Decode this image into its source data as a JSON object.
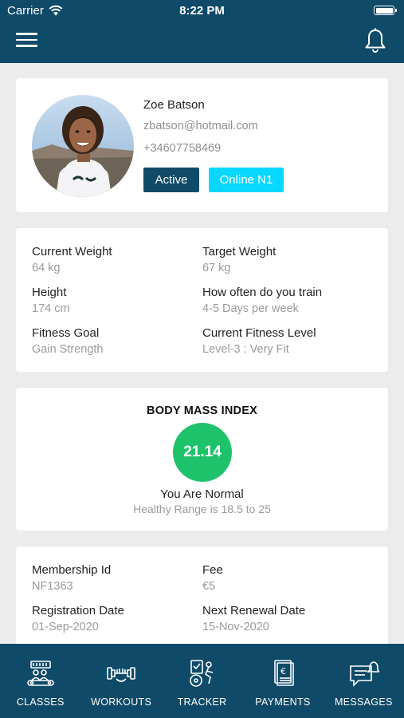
{
  "status_bar": {
    "carrier": "Carrier",
    "time": "8:22 PM"
  },
  "profile": {
    "name": "Zoe Batson",
    "email": "zbatson@hotmail.com",
    "phone": "+34607758469",
    "status_badge": "Active",
    "plan_badge": "Online N1"
  },
  "details": {
    "current_weight": {
      "label": "Current Weight",
      "value": "64 kg"
    },
    "target_weight": {
      "label": "Target Weight",
      "value": "67 kg"
    },
    "height": {
      "label": "Height",
      "value": "174 cm"
    },
    "training_frequency": {
      "label": "How often do you train",
      "value": "4-5 Days per week"
    },
    "fitness_goal": {
      "label": "Fitness Goal",
      "value": "Gain Strength"
    },
    "fitness_level": {
      "label": "Current Fitness Level",
      "value": "Level-3 : Very Fit"
    }
  },
  "bmi": {
    "title": "BODY MASS INDEX",
    "value": "21.14",
    "status": "You Are Normal",
    "range": "Healthy Range is 18.5 to 25",
    "color": "#1ec26a"
  },
  "membership": {
    "membership_id": {
      "label": "Membership Id",
      "value": "NF1363"
    },
    "fee": {
      "label": "Fee",
      "value": "€5"
    },
    "registration_date": {
      "label": "Registration Date",
      "value": "01-Sep-2020"
    },
    "next_renewal": {
      "label": "Next Renewal Date",
      "value": "15-Nov-2020"
    }
  },
  "tabs": [
    {
      "label": "CLASSES",
      "icon": "classes-icon"
    },
    {
      "label": "WORKOUTS",
      "icon": "dumbbell-icon"
    },
    {
      "label": "TRACKER",
      "icon": "tracker-icon"
    },
    {
      "label": "PAYMENTS",
      "icon": "euro-bill-icon"
    },
    {
      "label": "MESSAGES",
      "icon": "chat-bell-icon"
    }
  ],
  "colors": {
    "primary": "#0f4a68",
    "accent": "#0ad7ff",
    "bmi_normal": "#1ec26a",
    "background": "#ececec"
  }
}
